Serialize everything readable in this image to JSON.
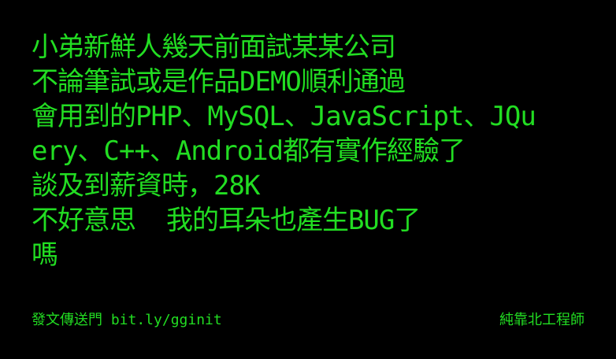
{
  "post": {
    "lines": [
      "小弟新鮮人幾天前面試某某公司",
      "不論筆試或是作品DEMO順利通過",
      "會用到的PHP、MySQL、JavaScript、JQu",
      "ery、C++、Android都有實作經驗了",
      "談及到薪資時，28K",
      "不好意思  我的耳朵也產生BUG了",
      "嗎"
    ]
  },
  "footer": {
    "link_text": "發文傳送門 bit.ly/gginit",
    "signature": "純靠北工程師"
  },
  "colors": {
    "background": "#000000",
    "text": "#22dd22"
  }
}
